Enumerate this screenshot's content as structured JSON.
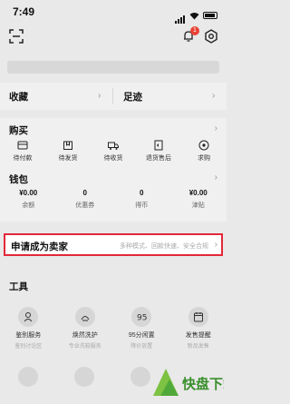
{
  "status": {
    "time": "7:49"
  },
  "header": {
    "notification_count": "1"
  },
  "shortcuts": [
    {
      "label": "收藏"
    },
    {
      "label": "足迹"
    }
  ],
  "buy": {
    "title": "购买",
    "items": [
      {
        "label": "待付款",
        "icon": "wallet-icon"
      },
      {
        "label": "待发货",
        "icon": "box-icon"
      },
      {
        "label": "待收货",
        "icon": "truck-icon"
      },
      {
        "label": "退货售后",
        "icon": "return-icon"
      },
      {
        "label": "求购",
        "icon": "seek-icon"
      }
    ]
  },
  "wallet": {
    "title": "钱包",
    "items": [
      {
        "value": "¥0.00",
        "label": "余额"
      },
      {
        "value": "0",
        "label": "优惠券"
      },
      {
        "value": "0",
        "label": "得币"
      },
      {
        "value": "¥0.00",
        "label": "津贴"
      }
    ]
  },
  "seller": {
    "title": "申请成为卖家",
    "subtitle": "多种模式、回款快速、安全合规"
  },
  "tools": {
    "title": "工具",
    "items": [
      {
        "name": "鉴别服务",
        "desc": "鉴别讨论区",
        "icon": "appraisal-icon"
      },
      {
        "name": "焕然洗护",
        "desc": "专业洗鞋服务",
        "icon": "care-icon"
      },
      {
        "name": "95分闲置",
        "desc": "降价放置",
        "icon": "idle-icon"
      },
      {
        "name": "发售提醒",
        "desc": "新品发售",
        "icon": "calendar-icon"
      }
    ]
  },
  "watermark": {
    "text": "快盘下载"
  },
  "colors": {
    "accent": "#e3283a",
    "background": "#e9e9e9"
  }
}
